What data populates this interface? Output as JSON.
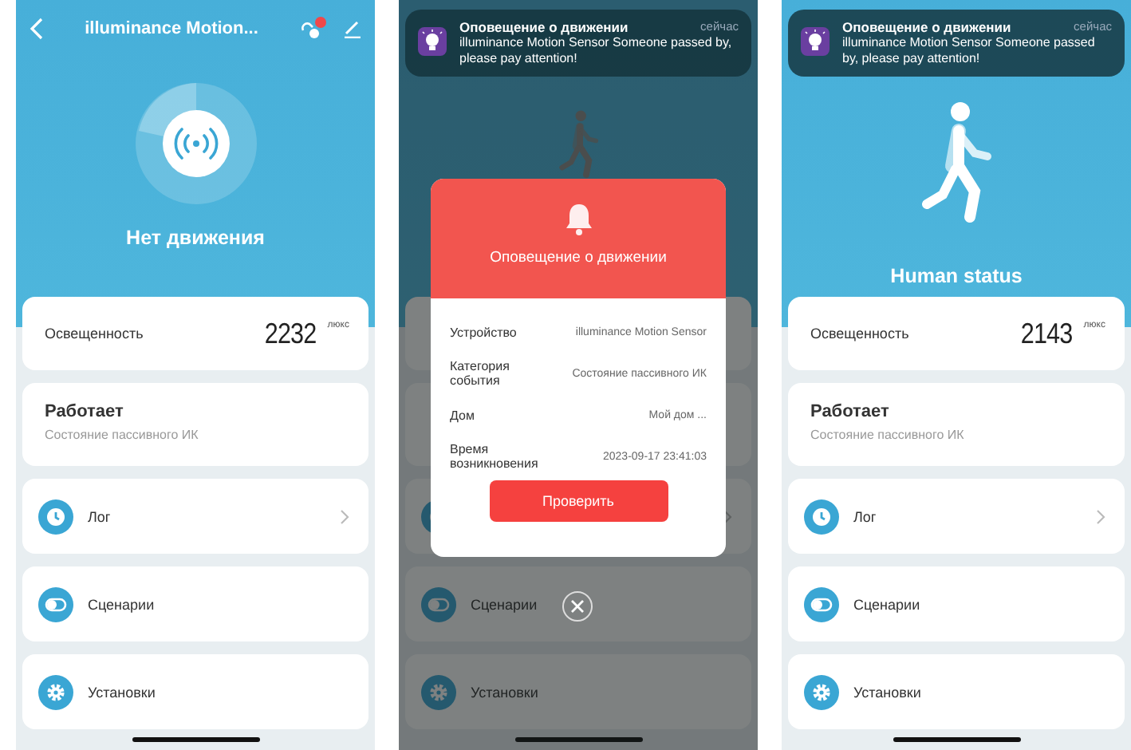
{
  "screens": [
    {
      "kind": "normal",
      "header": {
        "title": "illuminance Motion..."
      },
      "hero": {
        "kind": "idle",
        "label": "Нет движения"
      },
      "illuminance": {
        "label": "Освещенность",
        "value": "2232",
        "unit": "люкс"
      },
      "state": {
        "title": "Работает",
        "subtitle": "Состояние пассивного ИК"
      },
      "menu": [
        {
          "label": "Лог",
          "chevron": true
        },
        {
          "label": "Сценарии",
          "chevron": false
        },
        {
          "label": "Установки",
          "chevron": false
        }
      ]
    },
    {
      "kind": "alert",
      "notification": {
        "title": "Оповещение о движении",
        "time": "сейчас",
        "text": "illuminance Motion Sensor Someone passed by, please pay attention!"
      },
      "hero": {
        "kind": "motion"
      },
      "menu": [
        {
          "chevron": true
        },
        {
          "label": "Сценарии",
          "chevron": false
        },
        {
          "label": "Установки",
          "chevron": false
        }
      ],
      "dialog": {
        "title": "Оповещение о движении",
        "rows": [
          {
            "label": "Устройство",
            "value": "illuminance Motion Sensor"
          },
          {
            "label": "Категория события",
            "value": "Состояние пассивного ИК"
          },
          {
            "label": "Дом",
            "value": "Мой дом ..."
          },
          {
            "label": "Время возникновения",
            "value": "2023-09-17 23:41:03"
          }
        ],
        "button": "Проверить"
      }
    },
    {
      "kind": "normal",
      "notification": {
        "title": "Оповещение о движении",
        "time": "сейчас",
        "text": "illuminance Motion Sensor Someone passed by, please pay attention!"
      },
      "hero": {
        "kind": "motion",
        "label": "Human status"
      },
      "illuminance": {
        "label": "Освещенность",
        "value": "2143",
        "unit": "люкс"
      },
      "state": {
        "title": "Работает",
        "subtitle": "Состояние пассивного ИК"
      },
      "menu": [
        {
          "label": "Лог",
          "chevron": true
        },
        {
          "label": "Сценарии",
          "chevron": false
        },
        {
          "label": "Установки",
          "chevron": false
        }
      ]
    }
  ]
}
